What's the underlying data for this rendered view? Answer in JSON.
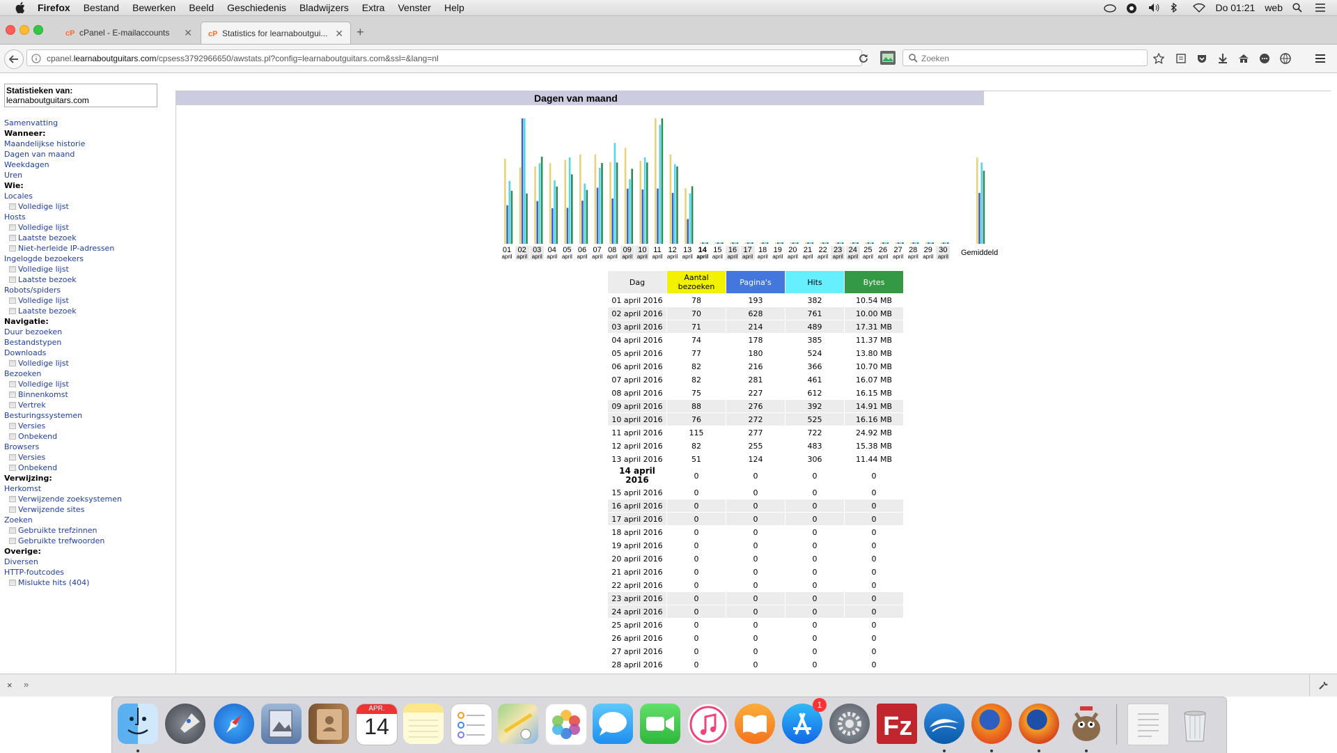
{
  "menubar": {
    "items": [
      "Firefox",
      "Bestand",
      "Bewerken",
      "Beeld",
      "Geschiedenis",
      "Bladwijzers",
      "Extra",
      "Venster",
      "Help"
    ],
    "clock": "Do 01:21",
    "user": "web"
  },
  "tabs": [
    {
      "title": "cPanel - E-mailaccounts",
      "active": false
    },
    {
      "title": "Statistics for learnaboutgui...",
      "active": true
    }
  ],
  "navbar": {
    "url_prefix": "cpanel.",
    "url_domain": "learnaboutguitars.com",
    "url_rest": "/cpsess3792966650/awstats.pl?config=learnaboutguitars.com&ssl=&lang=nl",
    "search_placeholder": "Zoeken"
  },
  "sidebar": {
    "stat_label": "Statistieken van:",
    "stat_site": "learnaboutguitars.com",
    "items": [
      {
        "label": "Samenvatting",
        "kind": "link"
      },
      {
        "label": "Wanneer:",
        "kind": "head"
      },
      {
        "label": "Maandelijkse historie",
        "kind": "link"
      },
      {
        "label": "Dagen van maand",
        "kind": "link"
      },
      {
        "label": "Weekdagen",
        "kind": "link"
      },
      {
        "label": "Uren",
        "kind": "link"
      },
      {
        "label": "Wie:",
        "kind": "head"
      },
      {
        "label": "Locales",
        "kind": "link"
      },
      {
        "label": "Volledige lijst",
        "kind": "sub"
      },
      {
        "label": "Hosts",
        "kind": "link"
      },
      {
        "label": "Volledige lijst",
        "kind": "sub"
      },
      {
        "label": "Laatste bezoek",
        "kind": "sub"
      },
      {
        "label": "Niet-herleide IP-adressen",
        "kind": "sub"
      },
      {
        "label": "Ingelogde bezoekers",
        "kind": "link"
      },
      {
        "label": "Volledige lijst",
        "kind": "sub"
      },
      {
        "label": "Laatste bezoek",
        "kind": "sub"
      },
      {
        "label": "Robots/spiders",
        "kind": "link"
      },
      {
        "label": "Volledige lijst",
        "kind": "sub"
      },
      {
        "label": "Laatste bezoek",
        "kind": "sub"
      },
      {
        "label": "Navigatie:",
        "kind": "head"
      },
      {
        "label": "Duur bezoeken",
        "kind": "link"
      },
      {
        "label": "Bestandstypen",
        "kind": "link"
      },
      {
        "label": "Downloads",
        "kind": "link"
      },
      {
        "label": "Volledige lijst",
        "kind": "sub"
      },
      {
        "label": "Bezoeken",
        "kind": "link"
      },
      {
        "label": "Volledige lijst",
        "kind": "sub"
      },
      {
        "label": "Binnenkomst",
        "kind": "sub"
      },
      {
        "label": "Vertrek",
        "kind": "sub"
      },
      {
        "label": "Besturingssystemen",
        "kind": "link"
      },
      {
        "label": "Versies",
        "kind": "sub"
      },
      {
        "label": "Onbekend",
        "kind": "sub"
      },
      {
        "label": "Browsers",
        "kind": "link"
      },
      {
        "label": "Versies",
        "kind": "sub"
      },
      {
        "label": "Onbekend",
        "kind": "sub"
      },
      {
        "label": "Verwijzing:",
        "kind": "head"
      },
      {
        "label": "Herkomst",
        "kind": "link"
      },
      {
        "label": "Verwijzende zoeksystemen",
        "kind": "sub"
      },
      {
        "label": "Verwijzende sites",
        "kind": "sub"
      },
      {
        "label": "Zoeken",
        "kind": "link"
      },
      {
        "label": "Gebruikte trefzinnen",
        "kind": "sub"
      },
      {
        "label": "Gebruikte trefwoorden",
        "kind": "sub"
      },
      {
        "label": "Overige:",
        "kind": "head"
      },
      {
        "label": "Diversen",
        "kind": "link"
      },
      {
        "label": "HTTP-foutcodes",
        "kind": "link"
      },
      {
        "label": "Mislukte hits (404)",
        "kind": "sub"
      }
    ]
  },
  "section_title": "Dagen van maand",
  "chart_data": {
    "type": "bar",
    "categories": [
      "01",
      "02",
      "03",
      "04",
      "05",
      "06",
      "07",
      "08",
      "09",
      "10",
      "11",
      "12",
      "13",
      "14",
      "15",
      "16",
      "17",
      "18",
      "19",
      "20",
      "21",
      "22",
      "23",
      "24",
      "25",
      "26",
      "27",
      "28",
      "29",
      "30"
    ],
    "month_label": "april",
    "average_label": "Gemiddeld",
    "weekend_days": [
      "02",
      "03",
      "09",
      "10",
      "16",
      "17",
      "23",
      "24",
      "30"
    ],
    "today": "14",
    "series": [
      {
        "name": "Aantal bezoeken",
        "color": "#e8d37a",
        "values": [
          78,
          70,
          71,
          74,
          77,
          82,
          82,
          75,
          88,
          76,
          115,
          82,
          51,
          0,
          0,
          0,
          0,
          0,
          0,
          0,
          0,
          0,
          0,
          0,
          0,
          0,
          0,
          0,
          0,
          0
        ],
        "average": 79
      },
      {
        "name": "Pagina's",
        "color": "#3a62c8",
        "values": [
          193,
          628,
          214,
          178,
          180,
          216,
          281,
          227,
          276,
          272,
          277,
          255,
          124,
          0,
          0,
          0,
          0,
          0,
          0,
          0,
          0,
          0,
          0,
          0,
          0,
          0,
          0,
          0,
          0,
          0
        ],
        "average": 255
      },
      {
        "name": "Hits",
        "color": "#55d7e8",
        "values": [
          382,
          761,
          489,
          385,
          524,
          366,
          461,
          612,
          392,
          525,
          722,
          483,
          306,
          0,
          0,
          0,
          0,
          0,
          0,
          0,
          0,
          0,
          0,
          0,
          0,
          0,
          0,
          0,
          0,
          0
        ],
        "average": 493
      },
      {
        "name": "Bytes",
        "color": "#2f8a57",
        "values": [
          10.54,
          10.0,
          17.31,
          11.37,
          13.8,
          10.7,
          16.07,
          16.15,
          14.91,
          16.16,
          24.92,
          15.38,
          11.44,
          0,
          0,
          0,
          0,
          0,
          0,
          0,
          0,
          0,
          0,
          0,
          0,
          0,
          0,
          0,
          0,
          0
        ],
        "average": 14.52
      }
    ]
  },
  "table": {
    "headers": [
      "Dag",
      "Aantal bezoeken",
      "Pagina's",
      "Hits",
      "Bytes"
    ],
    "header_colors": [
      "#ececec",
      "#f2f200",
      "#4477dd",
      "#66f0ff",
      "#339944"
    ],
    "rows": [
      [
        "01 april 2016",
        "78",
        "193",
        "382",
        "10.54 MB"
      ],
      [
        "02 april 2016",
        "70",
        "628",
        "761",
        "10.00 MB"
      ],
      [
        "03 april 2016",
        "71",
        "214",
        "489",
        "17.31 MB"
      ],
      [
        "04 april 2016",
        "74",
        "178",
        "385",
        "11.37 MB"
      ],
      [
        "05 april 2016",
        "77",
        "180",
        "524",
        "13.80 MB"
      ],
      [
        "06 april 2016",
        "82",
        "216",
        "366",
        "10.70 MB"
      ],
      [
        "07 april 2016",
        "82",
        "281",
        "461",
        "16.07 MB"
      ],
      [
        "08 april 2016",
        "75",
        "227",
        "612",
        "16.15 MB"
      ],
      [
        "09 april 2016",
        "88",
        "276",
        "392",
        "14.91 MB"
      ],
      [
        "10 april 2016",
        "76",
        "272",
        "525",
        "16.16 MB"
      ],
      [
        "11 april 2016",
        "115",
        "277",
        "722",
        "24.92 MB"
      ],
      [
        "12 april 2016",
        "82",
        "255",
        "483",
        "15.38 MB"
      ],
      [
        "13 april 2016",
        "51",
        "124",
        "306",
        "11.44 MB"
      ],
      [
        "14 april 2016",
        "0",
        "0",
        "0",
        "0"
      ],
      [
        "15 april 2016",
        "0",
        "0",
        "0",
        "0"
      ],
      [
        "16 april 2016",
        "0",
        "0",
        "0",
        "0"
      ],
      [
        "17 april 2016",
        "0",
        "0",
        "0",
        "0"
      ],
      [
        "18 april 2016",
        "0",
        "0",
        "0",
        "0"
      ],
      [
        "19 april 2016",
        "0",
        "0",
        "0",
        "0"
      ],
      [
        "20 april 2016",
        "0",
        "0",
        "0",
        "0"
      ],
      [
        "21 april 2016",
        "0",
        "0",
        "0",
        "0"
      ],
      [
        "22 april 2016",
        "0",
        "0",
        "0",
        "0"
      ],
      [
        "23 april 2016",
        "0",
        "0",
        "0",
        "0"
      ],
      [
        "24 april 2016",
        "0",
        "0",
        "0",
        "0"
      ],
      [
        "25 april 2016",
        "0",
        "0",
        "0",
        "0"
      ],
      [
        "26 april 2016",
        "0",
        "0",
        "0",
        "0"
      ],
      [
        "27 april 2016",
        "0",
        "0",
        "0",
        "0"
      ],
      [
        "28 april 2016",
        "0",
        "0",
        "0",
        "0"
      ]
    ]
  },
  "dock": {
    "icons": [
      "finder-icon",
      "launchpad-icon",
      "safari-icon",
      "preview-icon",
      "contacts-icon",
      "calendar-icon",
      "notes-icon",
      "reminders-icon",
      "maps-icon",
      "photos-icon",
      "messages-icon",
      "facetime-icon",
      "itunes-icon",
      "ibooks-icon",
      "app-store-icon",
      "system-preferences-icon",
      "filezilla-icon",
      "openoffice-icon",
      "firefox-icon",
      "firefox-dev-icon",
      "gimp-icon",
      "documents-icon",
      "trash-icon"
    ],
    "calendar_month": "APR.",
    "calendar_day": "14",
    "app_store_badge": "1"
  }
}
